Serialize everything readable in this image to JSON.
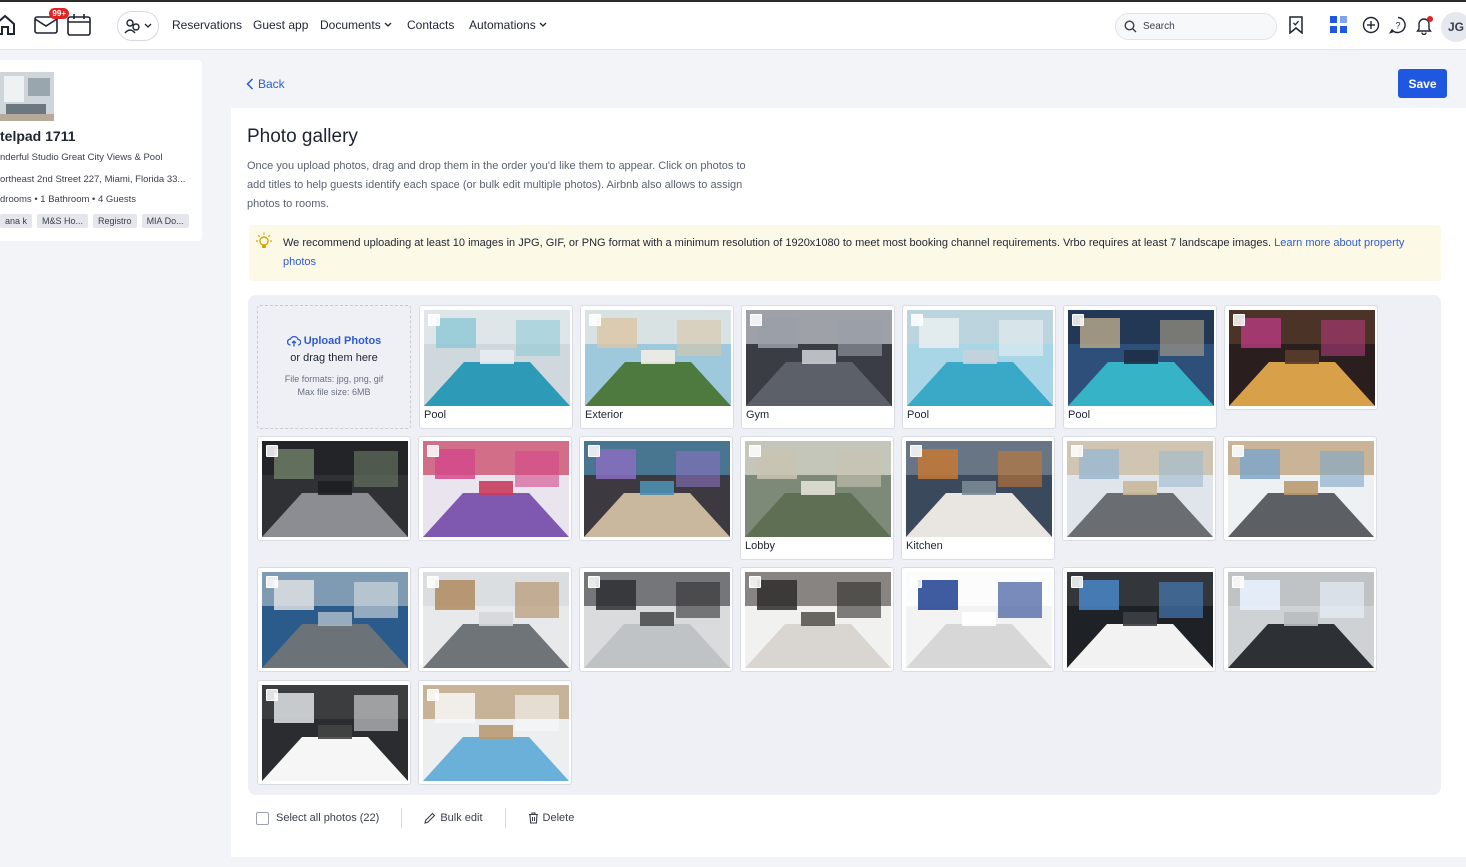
{
  "header": {
    "inbox_badge": "99+",
    "nav": [
      {
        "label": "Reservations",
        "dropdown": false
      },
      {
        "label": "Guest app",
        "dropdown": false
      },
      {
        "label": "Documents",
        "dropdown": true
      },
      {
        "label": "Contacts",
        "dropdown": false
      },
      {
        "label": "Automations",
        "dropdown": true
      }
    ],
    "search_placeholder": "Search",
    "avatar_initials": "JG"
  },
  "property": {
    "title": "telpad 1711",
    "subtitle": "nderful Studio Great City Views & Pool",
    "address": "ortheast 2nd Street 227, Miami, Florida 33...",
    "stats": "drooms  •  1 Bathroom  •  4 Guests",
    "tags": [
      "ana k",
      "M&S Ho...",
      "Registro",
      "MIA Do..."
    ]
  },
  "toolbar": {
    "back_label": "Back",
    "save_label": "Save"
  },
  "gallery": {
    "title": "Photo gallery",
    "intro": "Once you upload photos, drag and drop them in the order you'd like them to appear. Click on photos to add titles to help guests identify each space (or bulk edit multiple photos). Airbnb also allows to assign photos to rooms.",
    "notice": "We recommend uploading at least 10 images in JPG, GIF, or PNG format with a minimum resolution of 1920x1080 to meet most booking channel requirements. Vrbo requires at least 7 landscape images.",
    "notice_link": "Learn more about property photos",
    "upload": {
      "link": "Upload Photos",
      "drag": "or drag them here",
      "formats": "File formats: jpg, png, gif",
      "max_size": "Max file size: 6MB"
    },
    "photos": [
      {
        "label": "Pool",
        "scene": "pool"
      },
      {
        "label": "Exterior",
        "scene": "exterior"
      },
      {
        "label": "Gym",
        "scene": "gym"
      },
      {
        "label": "Pool",
        "scene": "pool2"
      },
      {
        "label": "Pool",
        "scene": "pool3"
      },
      {
        "label": "",
        "scene": "bar"
      },
      {
        "label": "",
        "scene": "gym2"
      },
      {
        "label": "",
        "scene": "lounge"
      },
      {
        "label": "",
        "scene": "pods"
      },
      {
        "label": "Lobby",
        "scene": "lobby"
      },
      {
        "label": "Kitchen",
        "scene": "kitchen"
      },
      {
        "label": "",
        "scene": "studio"
      },
      {
        "label": "",
        "scene": "studio2"
      },
      {
        "label": "",
        "scene": "living"
      },
      {
        "label": "",
        "scene": "studio3"
      },
      {
        "label": "",
        "scene": "kitchenette"
      },
      {
        "label": "",
        "scene": "closet"
      },
      {
        "label": "",
        "scene": "laundry"
      },
      {
        "label": "",
        "scene": "bath"
      },
      {
        "label": "",
        "scene": "bath2"
      },
      {
        "label": "",
        "scene": "bath3"
      },
      {
        "label": "",
        "scene": "bedroom"
      }
    ]
  },
  "actions": {
    "select_all": "Select all photos (22)",
    "bulk_edit": "Bulk edit",
    "delete": "Delete"
  },
  "colors": {
    "accent": "#1f57e0",
    "link": "#2f5bd3",
    "notice_bg": "#fdf9e7"
  }
}
